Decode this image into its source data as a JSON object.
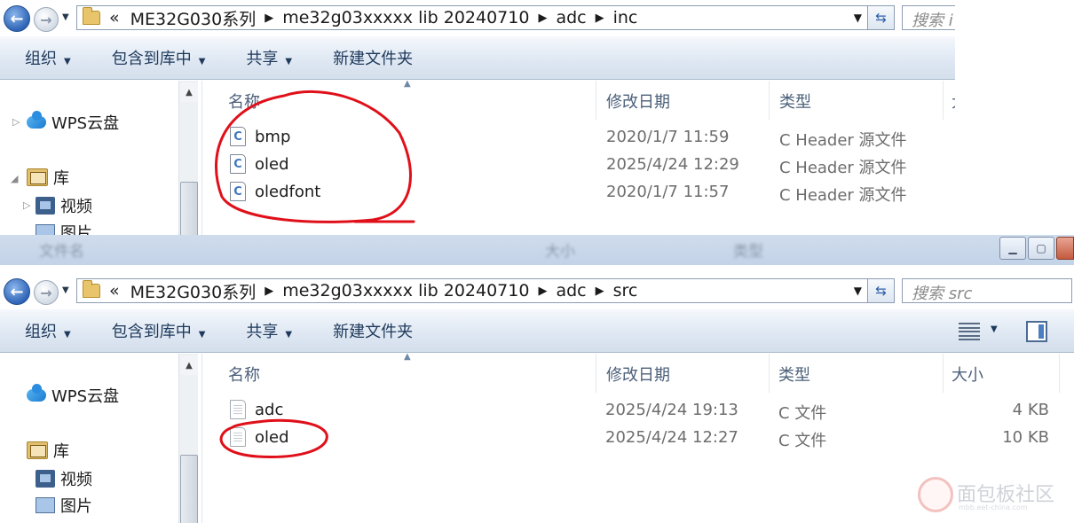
{
  "window_top": {
    "address": {
      "overflow": "«",
      "crumbs": [
        "ME32G030系列",
        "me32g03xxxxx lib 20240710",
        "adc",
        "inc"
      ]
    },
    "search_placeholder": "搜索 i",
    "toolbar": {
      "organize": "组织",
      "include_library": "包含到库中",
      "share": "共享",
      "new_folder": "新建文件夹"
    },
    "nav": {
      "wps_cloud": "WPS云盘",
      "library": "库",
      "videos": "视频",
      "pictures": "图片"
    },
    "columns": {
      "name": "名称",
      "modified": "修改日期",
      "type": "类型",
      "size": "大"
    },
    "files": [
      {
        "name": "bmp",
        "modified": "2020/1/7 11:59",
        "type": "C Header 源文件",
        "icon": "c-header-file-icon"
      },
      {
        "name": "oled",
        "modified": "2025/4/24 12:29",
        "type": "C Header 源文件",
        "icon": "c-header-file-icon"
      },
      {
        "name": "oledfont",
        "modified": "2020/1/7 11:57",
        "type": "C Header 源文件",
        "icon": "c-header-file-icon"
      }
    ]
  },
  "window_bottom": {
    "blurred_header": {
      "name": "文件名",
      "size": "大小",
      "type": "类型"
    },
    "address": {
      "overflow": "«",
      "crumbs": [
        "ME32G030系列",
        "me32g03xxxxx lib 20240710",
        "adc",
        "src"
      ]
    },
    "search_placeholder": "搜索 src",
    "toolbar": {
      "organize": "组织",
      "include_library": "包含到库中",
      "share": "共享",
      "new_folder": "新建文件夹"
    },
    "nav": {
      "wps_cloud": "WPS云盘",
      "library": "库",
      "videos": "视频",
      "pictures": "图片"
    },
    "columns": {
      "name": "名称",
      "modified": "修改日期",
      "type": "类型",
      "size": "大小"
    },
    "files": [
      {
        "name": "adc",
        "modified": "2025/4/24 19:13",
        "type": "C 文件",
        "size": "4 KB",
        "icon": "c-source-file-icon"
      },
      {
        "name": "oled",
        "modified": "2025/4/24 12:27",
        "type": "C 文件",
        "size": "10 KB",
        "icon": "c-source-file-icon"
      }
    ]
  },
  "watermark": {
    "text": "面包板社区",
    "sub": "mbb.eet-china.com"
  },
  "colors": {
    "annotation_red": "#e0101a",
    "toolbar_blue": "#dfe8f3"
  }
}
